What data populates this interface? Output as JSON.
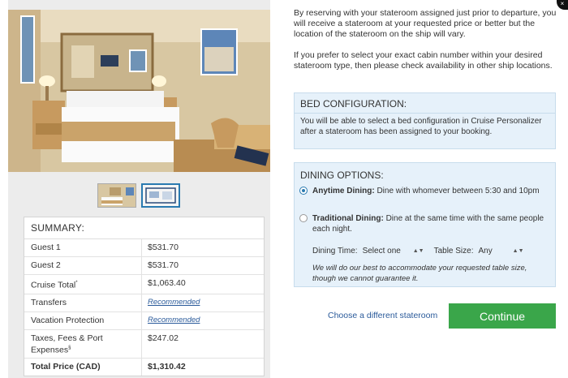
{
  "summary": {
    "title": "SUMMARY:",
    "rows": [
      {
        "label": "Guest 1",
        "value": "$531.70"
      },
      {
        "label": "Guest 2",
        "value": "$531.70"
      },
      {
        "label": "Cruise Total",
        "label_sup": "*",
        "value": "$1,063.40"
      },
      {
        "label": "Transfers",
        "value": "Recommended"
      },
      {
        "label": "Vacation Protection",
        "value": "Recommended"
      },
      {
        "label": "Taxes, Fees & Port Expenses",
        "label_sup": "§",
        "value": "$247.02"
      },
      {
        "label": "Total Price (CAD)",
        "value": "$1,310.42"
      }
    ]
  },
  "intro": {
    "p1": "By reserving with your stateroom assigned just prior to departure, you will receive a stateroom at your requested price or better but the location of the stateroom on the ship will vary.",
    "p2": "If you prefer to select your exact cabin number within your desired stateroom type, then please check availability in other ship locations."
  },
  "bed": {
    "title": "BED CONFIGURATION:",
    "line1": "You will be able to select a bed configuration in Cruise Personalizer",
    "line2": "after a stateroom has been assigned to your booking."
  },
  "dining": {
    "title": "DINING OPTIONS:",
    "options": [
      {
        "name": "Anytime Dining:",
        "desc": "Dine with whomever between 5:30 and 10pm",
        "selected": true
      },
      {
        "name": "Traditional Dining:",
        "desc": "Dine at the same time with the same people each night.",
        "selected": false
      }
    ],
    "time_label": "Dining Time:",
    "time_value": "Select one",
    "table_label": "Table Size:",
    "table_value": "Any",
    "note": "We will do our best to accommodate your requested table size, though we cannot guarantee it."
  },
  "actions": {
    "choose_link": "Choose a different stateroom",
    "continue_label": "Continue"
  },
  "colors": {
    "accent_blue": "#2a7ab0",
    "continue_green": "#3aa64a",
    "panel_blue": "#e6f1fa"
  },
  "icons": {
    "radio_selected": "radio-selected-icon",
    "radio_unselected": "radio-unselected-icon",
    "dropdown": "chevron-updown-icon"
  }
}
